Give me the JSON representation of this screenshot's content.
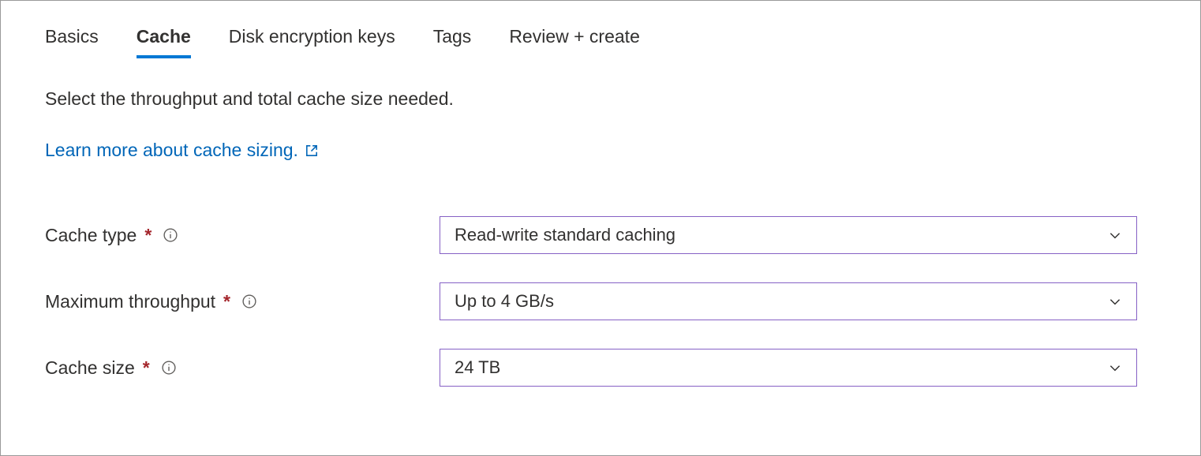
{
  "tabs": {
    "basics": "Basics",
    "cache": "Cache",
    "disk_encryption": "Disk encryption keys",
    "tags": "Tags",
    "review": "Review + create"
  },
  "description": "Select the throughput and total cache size needed.",
  "learn_link": "Learn more about cache sizing.",
  "fields": {
    "cache_type": {
      "label": "Cache type",
      "value": "Read-write standard caching"
    },
    "max_throughput": {
      "label": "Maximum throughput",
      "value": "Up to 4 GB/s"
    },
    "cache_size": {
      "label": "Cache size",
      "value": "24 TB"
    }
  },
  "required_marker": "*"
}
